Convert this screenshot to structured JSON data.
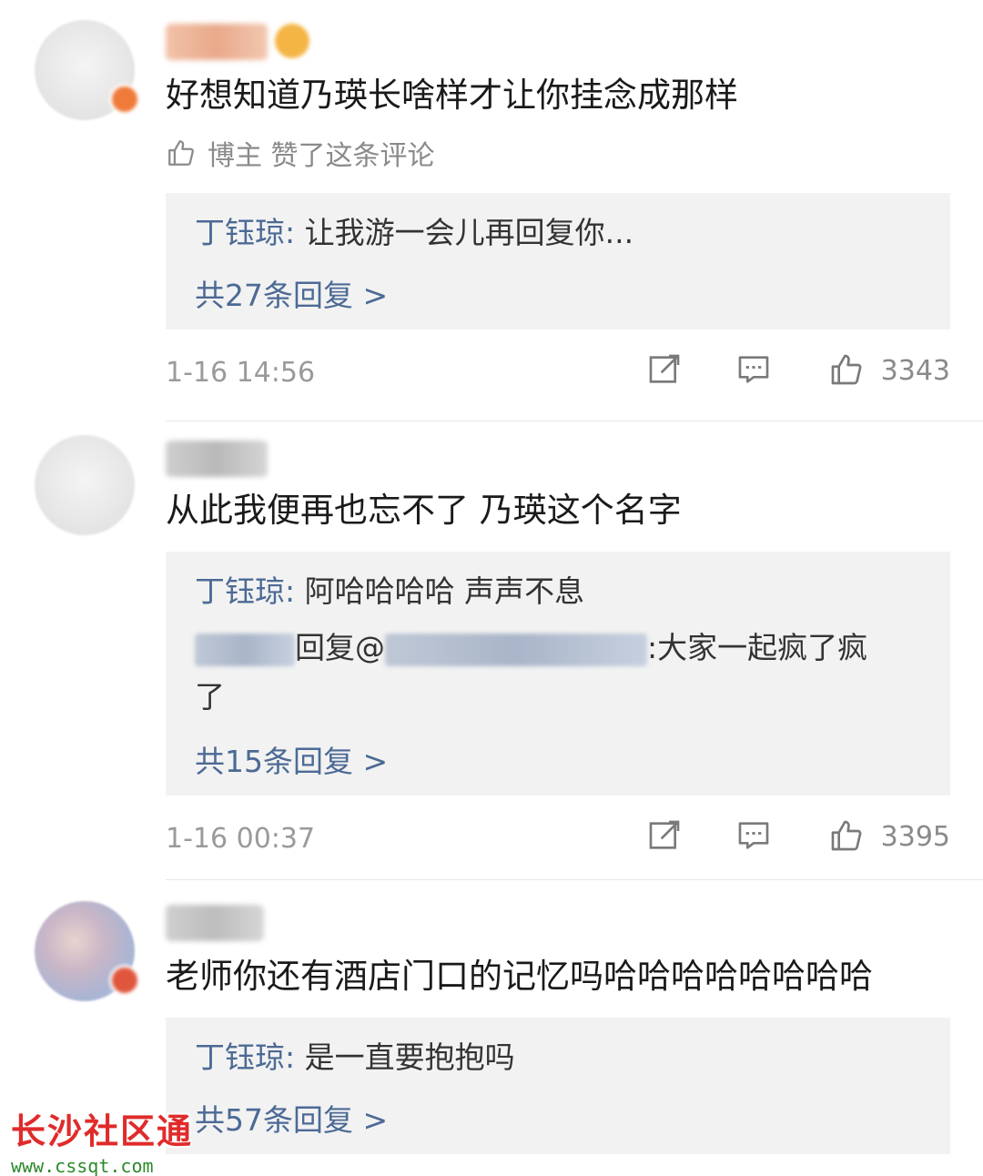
{
  "comments": [
    {
      "text": "好想知道乃瑛长啥样才让你挂念成那样",
      "liked_by_author": "博主 赞了这条评论",
      "reply": {
        "author": "丁钰琼",
        "separator": ": ",
        "text": "让我游一会儿再回复你..."
      },
      "reply_count": "共27条回复 >",
      "time": "1-16 14:56",
      "likes": "3343"
    },
    {
      "text": "从此我便再也忘不了 乃瑛这个名字",
      "reply": {
        "author": "丁钰琼",
        "separator": ": ",
        "text": "阿哈哈哈哈 声声不息"
      },
      "reply2": {
        "mid1": "回复@",
        "mid2": ":大家一起疯了疯",
        "wrap": "了"
      },
      "reply_count": "共15条回复 >",
      "time": "1-16 00:37",
      "likes": "3395"
    },
    {
      "text": "老师你还有酒店门口的记忆吗哈哈哈哈哈哈哈哈",
      "reply": {
        "author": "丁钰琼",
        "separator": ": ",
        "text": "是一直要抱抱吗"
      },
      "reply_count": "共57条回复 >"
    }
  ],
  "watermark": {
    "title": "长沙社区通",
    "url": "www.cssqt.com"
  },
  "colors": {
    "link": "#4c6a95",
    "reply_bg": "#f2f2f2",
    "watermark": "#e02b2b"
  },
  "icons": [
    "thumbs-up-icon",
    "share-icon",
    "comment-icon"
  ]
}
